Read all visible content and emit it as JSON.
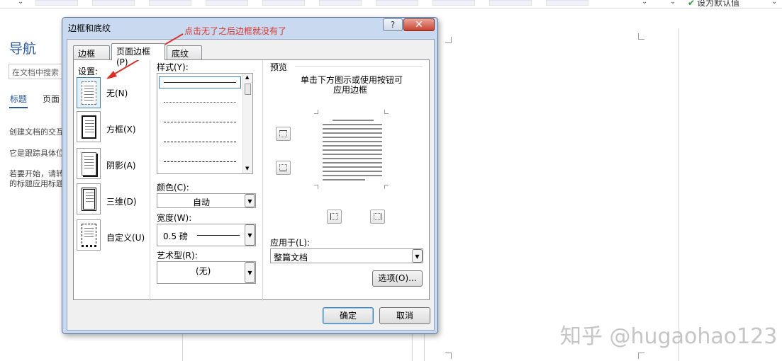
{
  "ribbon": {
    "set_default": "设为默认值"
  },
  "nav": {
    "title": "导航",
    "search_placeholder": "在文档中搜索",
    "tab_headings": "标题",
    "tab_pages": "页面",
    "line1": "创建文档的交互",
    "line2": "它是跟踪具体位",
    "line3": "若要开始，请转",
    "line4": "的标题应用标题"
  },
  "dialog": {
    "title": "边框和底纹",
    "help": "?",
    "close": "✕",
    "tabs": [
      "边框(B)",
      "页面边框(P)",
      "底纹(S)"
    ],
    "settings_label": "设置:",
    "settings": [
      "无(N)",
      "方框(X)",
      "阴影(A)",
      "三维(D)",
      "自定义(U)"
    ],
    "style_label": "样式(Y):",
    "color_label": "颜色(C):",
    "color_value": "自动",
    "width_label": "宽度(W):",
    "width_value": "0.5 磅",
    "art_label": "艺术型(R):",
    "art_value": "(无)",
    "preview_label": "预览",
    "preview_hint_1": "单击下方图示或使用按钮可",
    "preview_hint_2": "应用边框",
    "apply_label": "应用于(L):",
    "apply_value": "整篇文档",
    "options_button": "选项(O)...",
    "ok_button": "确定",
    "cancel_button": "取消"
  },
  "annotation": "点击无了之后边框就没有了",
  "watermark": "知乎 @hugaohao123",
  "colors": {
    "accent": "#2b579a",
    "annotation": "#d8312a",
    "dialog_frame": "#c9daf0"
  }
}
